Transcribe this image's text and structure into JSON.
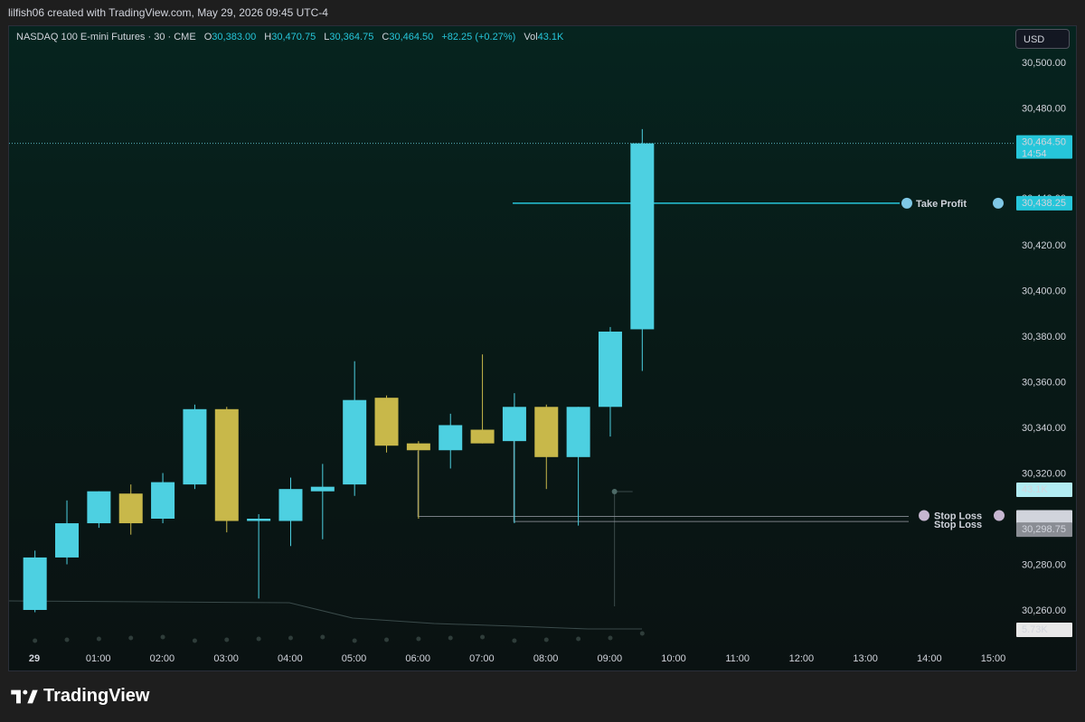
{
  "attribution": "lilfish06 created with TradingView.com, May 29, 2026 09:45 UTC-4",
  "legend": {
    "symbol": "NASDAQ 100 E-mini Futures · 30 · CME",
    "open_label": "O",
    "open": "30,383.00",
    "high_label": "H",
    "high": "30,470.75",
    "low_label": "L",
    "low": "30,364.75",
    "close_label": "C",
    "close": "30,464.50",
    "change": "+82.25 (+0.27%)",
    "vol_label": "Vol",
    "vol": "43.1K"
  },
  "currency": "USD",
  "brand": "TradingView",
  "colors": {
    "up": "#4dd0e1",
    "down": "#c8b84a",
    "accent": "#26c6da",
    "stop": "#9598a1"
  },
  "annotations": {
    "take_profit_label": "Take Profit",
    "take_profit_price": "30,438.25",
    "take_profit_hidden": "30,440.00",
    "stop_loss_label": "Stop Loss",
    "stop_loss_price_1": "30,301.00",
    "stop_loss_price_2": "30,298.75",
    "last_price": "30,464.50",
    "countdown": "14:54",
    "volume_badge": "43.1K",
    "volume_ma_badge": "5.73K"
  },
  "chart_data": {
    "type": "candlestick",
    "y_ticks": [
      "30,500.00",
      "30,480.00",
      "30,460.00",
      "30,440.00",
      "30,420.00",
      "30,400.00",
      "30,380.00",
      "30,360.00",
      "30,340.00",
      "30,320.00",
      "30,300.00",
      "30,280.00",
      "30,260.00"
    ],
    "x_ticks": [
      "29",
      "01:00",
      "02:00",
      "03:00",
      "04:00",
      "05:00",
      "06:00",
      "07:00",
      "08:00",
      "09:00",
      "10:00",
      "11:00",
      "12:00",
      "13:00",
      "14:00",
      "15:00"
    ],
    "ylim": [
      30252,
      30505
    ],
    "interval": "30m",
    "candles": [
      {
        "t": "00:00",
        "o": 30260,
        "h": 30286,
        "l": 30259,
        "c": 30283
      },
      {
        "t": "00:30",
        "o": 30283,
        "h": 30308,
        "l": 30280,
        "c": 30298
      },
      {
        "t": "01:00",
        "o": 30298,
        "h": 30312,
        "l": 30296,
        "c": 30312
      },
      {
        "t": "01:30",
        "o": 30311,
        "h": 30315,
        "l": 30293,
        "c": 30298
      },
      {
        "t": "02:00",
        "o": 30300,
        "h": 30320,
        "l": 30298,
        "c": 30316
      },
      {
        "t": "02:30",
        "o": 30315,
        "h": 30350,
        "l": 30313,
        "c": 30348
      },
      {
        "t": "03:00",
        "o": 30348,
        "h": 30349,
        "l": 30294,
        "c": 30299
      },
      {
        "t": "03:30",
        "o": 30299,
        "h": 30302,
        "l": 30265,
        "c": 30300
      },
      {
        "t": "04:00",
        "o": 30299,
        "h": 30318,
        "l": 30288,
        "c": 30313
      },
      {
        "t": "04:30",
        "o": 30312,
        "h": 30324,
        "l": 30291,
        "c": 30314
      },
      {
        "t": "05:00",
        "o": 30315,
        "h": 30369,
        "l": 30310,
        "c": 30352
      },
      {
        "t": "05:30",
        "o": 30353,
        "h": 30354,
        "l": 30329,
        "c": 30332
      },
      {
        "t": "06:00",
        "o": 30333,
        "h": 30334,
        "l": 30300,
        "c": 30330
      },
      {
        "t": "06:30",
        "o": 30330,
        "h": 30346,
        "l": 30322,
        "c": 30341
      },
      {
        "t": "07:00",
        "o": 30339,
        "h": 30372,
        "l": 30333,
        "c": 30333
      },
      {
        "t": "07:30",
        "o": 30334,
        "h": 30355,
        "l": 30298,
        "c": 30349
      },
      {
        "t": "08:00",
        "o": 30349,
        "h": 30350,
        "l": 30313,
        "c": 30327
      },
      {
        "t": "08:30",
        "o": 30327,
        "h": 30349,
        "l": 30297,
        "c": 30349
      },
      {
        "t": "09:00",
        "o": 30349,
        "h": 30384,
        "l": 30336,
        "c": 30382
      },
      {
        "t": "09:30",
        "o": 30383,
        "h": 30470.75,
        "l": 30364.75,
        "c": 30464.5
      }
    ],
    "take_profit": 30438.25,
    "stop_loss": [
      30301.0,
      30298.75
    ],
    "last_price": 30464.5
  }
}
